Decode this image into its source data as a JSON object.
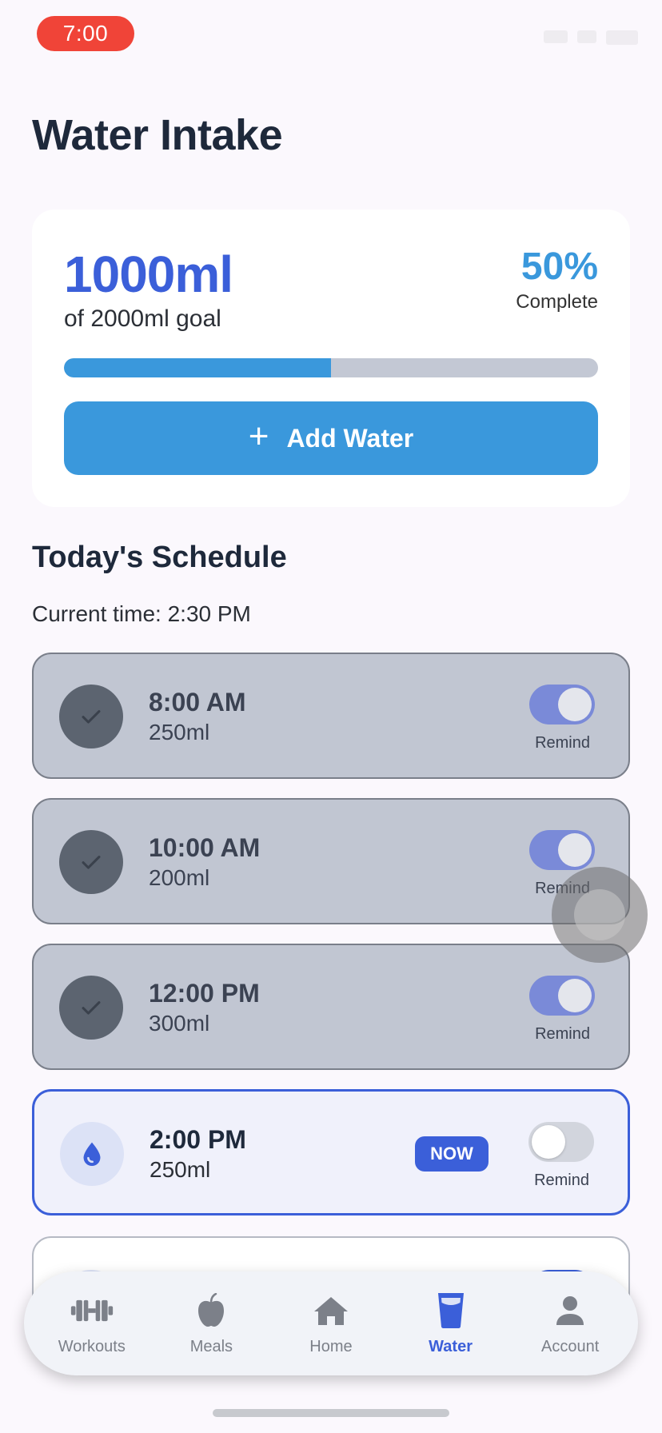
{
  "status_bar": {
    "time": "7:00"
  },
  "page": {
    "title": "Water Intake"
  },
  "summary": {
    "amount": "1000ml",
    "goal_text": "of 2000ml goal",
    "percent": "50%",
    "percent_label": "Complete",
    "progress_fraction": 0.5,
    "add_button_label": "Add Water"
  },
  "schedule": {
    "title": "Today's Schedule",
    "current_time": "Current time: 2:30 PM",
    "remind_label": "Remind",
    "now_badge": "NOW",
    "items": [
      {
        "time": "8:00 AM",
        "amount": "250ml",
        "status": "done",
        "remind": true
      },
      {
        "time": "10:00 AM",
        "amount": "200ml",
        "status": "done",
        "remind": true
      },
      {
        "time": "12:00 PM",
        "amount": "300ml",
        "status": "done",
        "remind": true
      },
      {
        "time": "2:00 PM",
        "amount": "250ml",
        "status": "current",
        "remind": false
      }
    ]
  },
  "nav": {
    "items": [
      {
        "label": "Workouts",
        "icon": "dumbbell-icon",
        "active": false
      },
      {
        "label": "Meals",
        "icon": "apple-icon",
        "active": false
      },
      {
        "label": "Home",
        "icon": "home-icon",
        "active": false
      },
      {
        "label": "Water",
        "icon": "water-glass-icon",
        "active": true
      },
      {
        "label": "Account",
        "icon": "account-icon",
        "active": false
      }
    ]
  },
  "colors": {
    "primary": "#3b5fd9",
    "accent": "#3a98dc",
    "done_card": "#c1c6d2",
    "alert_pill": "#f04438"
  }
}
